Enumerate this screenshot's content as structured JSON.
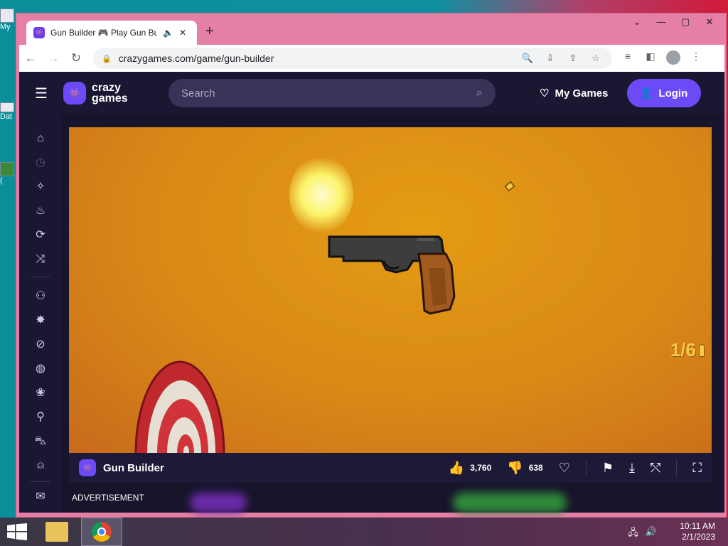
{
  "browser": {
    "tab_title": "Gun Builder 🎮 Play Gun Builder",
    "tab_audio_icon": "speaker-icon",
    "tab_close": "✕",
    "newtab": "+",
    "window_controls": [
      "⌄",
      "—",
      "▢",
      "✕"
    ],
    "url": "crazygames.com/game/gun-builder"
  },
  "site": {
    "logo_text_1": "crazy",
    "logo_text_2": "games",
    "search_placeholder": "Search",
    "mygames_label": "My Games",
    "login_label": "Login",
    "brand_color": "#6d4af7"
  },
  "game": {
    "ammo_text": "1/6",
    "title": "Gun Builder",
    "likes": "3,760",
    "dislikes": "638"
  },
  "page": {
    "advertisement": "ADVERTISEMENT"
  },
  "desktop": {
    "icon_label_1": "My",
    "icon_label_2": "Dat",
    "icon_label_3": "("
  },
  "taskbar": {
    "time": "10:11 AM",
    "date": "2/1/2023"
  }
}
